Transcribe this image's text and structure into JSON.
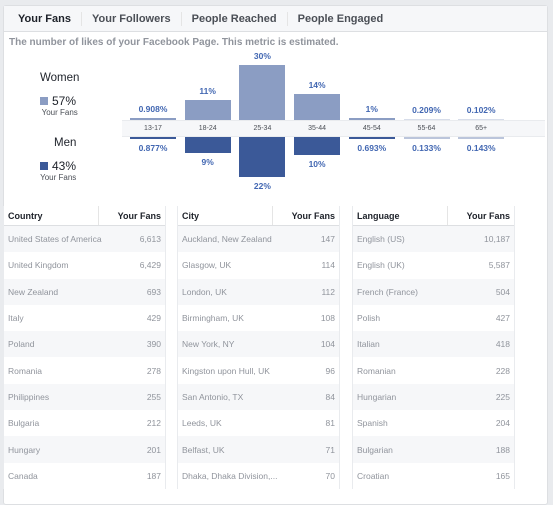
{
  "tabs": [
    "Your Fans",
    "Your Followers",
    "People Reached",
    "People Engaged"
  ],
  "description": "The number of likes of your Facebook Page. This metric is estimated.",
  "colors": {
    "women": "#8b9dc3",
    "men": "#3b5998",
    "label": "#4267b2"
  },
  "legend": {
    "women": {
      "name": "Women",
      "pct": "57%",
      "sub": "Your Fans"
    },
    "men": {
      "name": "Men",
      "pct": "43%",
      "sub": "Your Fans"
    }
  },
  "chart_data": {
    "type": "bar",
    "categories": [
      "13-17",
      "18-24",
      "25-34",
      "35-44",
      "45-54",
      "55-64",
      "65+"
    ],
    "series": [
      {
        "name": "Women",
        "values": [
          0.908,
          11,
          30,
          14,
          1,
          0.209,
          0.102
        ],
        "labels": [
          "0.908%",
          "11%",
          "30%",
          "14%",
          "1%",
          "0.209%",
          "0.102%"
        ]
      },
      {
        "name": "Men",
        "values": [
          0.877,
          9,
          22,
          10,
          0.693,
          0.133,
          0.143
        ],
        "labels": [
          "0.877%",
          "9%",
          "22%",
          "10%",
          "0.693%",
          "0.133%",
          "0.143%"
        ]
      }
    ]
  },
  "tables": [
    {
      "headers": [
        "Country",
        "Your Fans"
      ],
      "rows": [
        [
          "United States of America",
          "6,613"
        ],
        [
          "United Kingdom",
          "6,429"
        ],
        [
          "New Zealand",
          "693"
        ],
        [
          "Italy",
          "429"
        ],
        [
          "Poland",
          "390"
        ],
        [
          "Romania",
          "278"
        ],
        [
          "Philippines",
          "255"
        ],
        [
          "Bulgaria",
          "212"
        ],
        [
          "Hungary",
          "201"
        ],
        [
          "Canada",
          "187"
        ]
      ]
    },
    {
      "headers": [
        "City",
        "Your Fans"
      ],
      "rows": [
        [
          "Auckland, New Zealand",
          "147"
        ],
        [
          "Glasgow, UK",
          "114"
        ],
        [
          "London, UK",
          "112"
        ],
        [
          "Birmingham, UK",
          "108"
        ],
        [
          "New York, NY",
          "104"
        ],
        [
          "Kingston upon Hull, UK",
          "96"
        ],
        [
          "San Antonio, TX",
          "84"
        ],
        [
          "Leeds, UK",
          "81"
        ],
        [
          "Belfast, UK",
          "71"
        ],
        [
          "Dhaka, Dhaka Division,...",
          "70"
        ]
      ]
    },
    {
      "headers": [
        "Language",
        "Your Fans"
      ],
      "rows": [
        [
          "English (US)",
          "10,187"
        ],
        [
          "English (UK)",
          "5,587"
        ],
        [
          "French (France)",
          "504"
        ],
        [
          "Polish",
          "427"
        ],
        [
          "Italian",
          "418"
        ],
        [
          "Romanian",
          "228"
        ],
        [
          "Hungarian",
          "225"
        ],
        [
          "Spanish",
          "204"
        ],
        [
          "Bulgarian",
          "188"
        ],
        [
          "Croatian",
          "165"
        ]
      ]
    }
  ]
}
